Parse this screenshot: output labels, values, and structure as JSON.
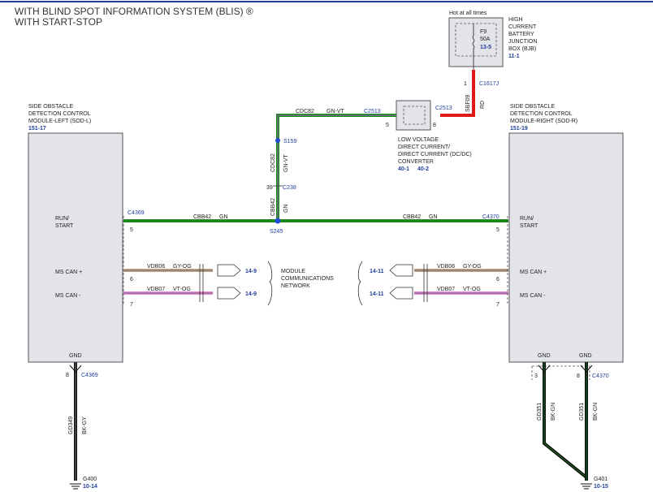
{
  "title": {
    "line1": "WITH BLIND SPOT INFORMATION SYSTEM (BLIS) ®",
    "line2": "WITH START-STOP"
  },
  "colors": {
    "header_rule": "#1f3f9a",
    "wire_green": "#1a8a1a",
    "wire_red": "#e01818",
    "wire_black": "#111111",
    "wire_gy_og": "#c2a58a",
    "wire_vt_og": "#e08ad8",
    "splice_blue": "#1f4fd8",
    "module_fill": "#e3e4ea",
    "ref_blue": "#1f3f9a"
  },
  "bjb": {
    "caption": "Hot at all times",
    "fuse": "F9",
    "rating": "50A",
    "ref": "13-5",
    "name": [
      "HIGH",
      "CURRENT",
      "BATTERY",
      "JUNCTION",
      "BOX (BJB)"
    ],
    "name_ref": "11-1",
    "pin": "1",
    "connector": "C1617J"
  },
  "dcdc": {
    "connector": "C2513",
    "pin_left": "5",
    "pin_right": "8",
    "name": [
      "LOW VOLTAGE",
      "DIRECT CURRENT/",
      "DIRECT CURRENT (DC/DC)",
      "CONVERTER"
    ],
    "ref1": "40-1",
    "ref2": "40-2"
  },
  "wires": {
    "sbf09": "SBF09",
    "rd": "RD",
    "cdc82": "CDC82",
    "gn_vt": "GN-VT",
    "cbb42": "CBB42",
    "gn": "GN",
    "vdb06": "VDB06",
    "gy_og": "GY-OG",
    "vdb07": "VDB07",
    "vt_og": "VT-OG",
    "gd349": "GD349",
    "bk_gy": "BK-GY",
    "gd351": "GD351",
    "bk_gn": "BK-GN"
  },
  "splices": {
    "s159": "S159",
    "c238": "C238",
    "c238_pin": "39",
    "s245": "S245"
  },
  "sod_l": {
    "name": [
      "SIDE OBSTACLE",
      "DETECTION CONTROL",
      "MODULE-LEFT (SOD-L)"
    ],
    "ref": "151-17",
    "run_start": [
      "RUN/",
      "START"
    ],
    "ms_can_plus": "MS CAN +",
    "ms_can_minus": "MS CAN -",
    "gnd": "GND",
    "connector": "C4369",
    "pin_run": "5",
    "pin_plus": "6",
    "pin_minus": "7",
    "pin_gnd": "8",
    "gnd_connector": "C4369"
  },
  "sod_r": {
    "name": [
      "SIDE OBSTACLE",
      "DETECTION CONTROL",
      "MODULE-RIGHT (SOD-R)"
    ],
    "ref": "151-19",
    "run_start": [
      "RUN/",
      "START"
    ],
    "ms_can_plus": "MS CAN +",
    "ms_can_minus": "MS CAN -",
    "gnd1": "GND",
    "gnd2": "GND",
    "connector": "C4370",
    "pin_run": "5",
    "pin_plus": "6",
    "pin_minus": "7",
    "pin_gnd1": "3",
    "pin_gnd2": "8",
    "gnd_connector": "C4370"
  },
  "network": {
    "label": [
      "MODULE",
      "COMMUNICATIONS",
      "NETWORK"
    ],
    "left_ref_plus": "14-9",
    "left_ref_minus": "14-9",
    "right_ref_plus": "14-11",
    "right_ref_minus": "14-11"
  },
  "grounds": {
    "g400": "G400",
    "g400_ref": "10-14",
    "g401": "G401",
    "g401_ref": "10-15"
  }
}
